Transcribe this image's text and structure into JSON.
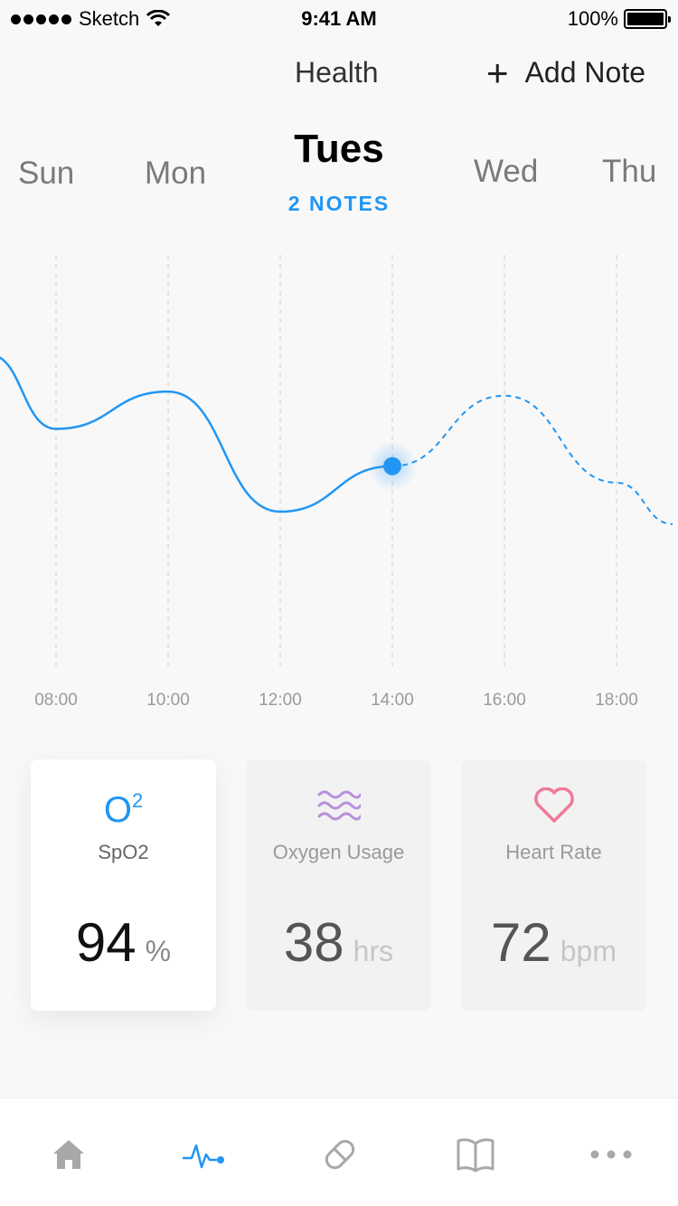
{
  "status_bar": {
    "carrier": "Sketch",
    "time": "9:41 AM",
    "battery": "100%"
  },
  "nav": {
    "title": "Health",
    "add_note": "Add Note"
  },
  "days": {
    "sun": "Sun",
    "mon": "Mon",
    "selected": "Tues",
    "selected_notes": "2 NOTES",
    "wed": "Wed",
    "thu": "Thu"
  },
  "chart_data": {
    "type": "line",
    "x": [
      "08:00",
      "10:00",
      "12:00",
      "14:00",
      "16:00",
      "18:00"
    ],
    "series": [
      {
        "values": [
          58,
          67,
          38,
          49,
          66,
          45
        ]
      }
    ],
    "current_point": "14:00",
    "grid": "vertical dashed",
    "accent_color": "#2196f3"
  },
  "cards": [
    {
      "icon": "o2-icon",
      "icon_text": "O",
      "icon_sup": "2",
      "label": "SpO2",
      "value": "94",
      "unit": "%",
      "active": true
    },
    {
      "icon": "waves-icon",
      "label": "Oxygen Usage",
      "value": "38",
      "unit": "hrs",
      "active": false
    },
    {
      "icon": "heart-icon",
      "label": "Heart Rate",
      "value": "72",
      "unit": "bpm",
      "active": false
    }
  ],
  "tabbar": {
    "items": [
      "home-icon",
      "activity-icon",
      "pill-icon",
      "book-icon",
      "more-icon"
    ],
    "active": "activity-icon"
  },
  "colors": {
    "accent": "#2196f3",
    "purple": "#b98fde",
    "pink": "#ef7a98"
  }
}
